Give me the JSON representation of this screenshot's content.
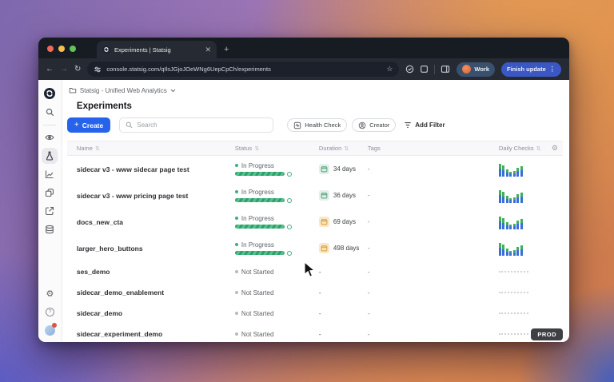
{
  "browser": {
    "tab_title": "Experiments | Statsig",
    "url": "console.statsig.com/qIlsJGjoJOeWNg6UepCpCh/experiments",
    "profile_label": "Work",
    "update_label": "Finish update",
    "toolbar_icons": [
      "back-icon",
      "forward-icon",
      "reload-icon",
      "site-info-icon",
      "star-icon",
      "extension-check-icon",
      "box-icon",
      "side-panel-icon",
      "kebab-menu-icon"
    ]
  },
  "page": {
    "breadcrumb": "Statsig - Unified Web Analytics",
    "title": "Experiments",
    "create_label": "Create",
    "search_placeholder": "Search",
    "filter_health_check": "Health Check",
    "filter_creator": "Creator",
    "filter_add": "Add Filter",
    "prod_badge": "PROD"
  },
  "sidebar": {
    "icons": [
      "statsig-logo",
      "search-icon",
      "feature-gates-eye-icon",
      "experiments-flask-icon",
      "metrics-chart-icon",
      "segments-icon",
      "export-icon",
      "console-database-icon",
      "settings-gear-icon",
      "help-icon",
      "user-avatar"
    ]
  },
  "colors": {
    "accent_blue": "#2563eb",
    "status_green": "#3fae7a",
    "duration_green": "#4f9f76",
    "duration_orange": "#d99a33",
    "spark_blue": "#3a6fd8",
    "spark_green": "#41b05c",
    "prod_bg": "#3f4043"
  },
  "table": {
    "columns": [
      "Name",
      "Status",
      "Duration",
      "Tags",
      "Daily Checks"
    ],
    "sparkline_bars": [
      {
        "h": 16,
        "g": 6
      },
      {
        "h": 14,
        "g": 6
      },
      {
        "h": 9,
        "g": 4
      },
      {
        "h": 6,
        "g": 2
      },
      {
        "h": 7,
        "g": 3
      },
      {
        "h": 11,
        "g": 4
      },
      {
        "h": 13,
        "g": 5
      }
    ],
    "rows": [
      {
        "name": "sidecar v3 - www sidecar page test",
        "status": "In Progress",
        "state": "in_progress",
        "duration": "34 days",
        "duration_icon": "green",
        "tags": "-",
        "daily_checks": "bars"
      },
      {
        "name": "sidecar v3 - www pricing page test",
        "status": "In Progress",
        "state": "in_progress",
        "duration": "36 days",
        "duration_icon": "green",
        "tags": "-",
        "daily_checks": "bars"
      },
      {
        "name": "docs_new_cta",
        "status": "In Progress",
        "state": "in_progress",
        "duration": "69 days",
        "duration_icon": "orange",
        "tags": "-",
        "daily_checks": "bars"
      },
      {
        "name": "larger_hero_buttons",
        "status": "In Progress",
        "state": "in_progress",
        "duration": "498 days",
        "duration_icon": "orange",
        "tags": "-",
        "daily_checks": "bars"
      },
      {
        "name": "ses_demo",
        "status": "Not Started",
        "state": "not_started",
        "duration": "-",
        "duration_icon": "",
        "tags": "-",
        "daily_checks": "dotted"
      },
      {
        "name": "sidecar_demo_enablement",
        "status": "Not Started",
        "state": "not_started",
        "duration": "-",
        "duration_icon": "",
        "tags": "-",
        "daily_checks": "dotted"
      },
      {
        "name": "sidecar_demo",
        "status": "Not Started",
        "state": "not_started",
        "duration": "-",
        "duration_icon": "",
        "tags": "-",
        "daily_checks": "dotted"
      },
      {
        "name": "sidecar_experiment_demo",
        "status": "Not Started",
        "state": "not_started",
        "duration": "-",
        "duration_icon": "",
        "tags": "-",
        "daily_checks": "dotted"
      }
    ]
  }
}
